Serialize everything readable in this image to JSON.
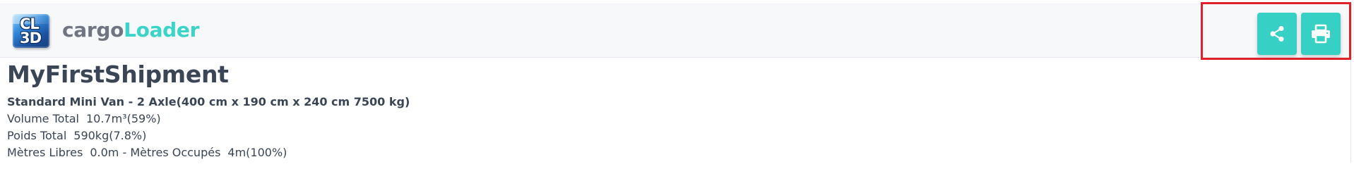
{
  "header": {
    "logo": {
      "line1": "CL",
      "line2": "3D"
    },
    "brand_part1": "cargo",
    "brand_part2": "Loader",
    "actions": [
      {
        "name": "share",
        "icon": "share-icon"
      },
      {
        "name": "print",
        "icon": "printer-icon"
      }
    ]
  },
  "shipment": {
    "title": "MyFirstShipment",
    "vehicle": "Standard Mini Van - 2 Axle(400 cm x 190 cm x 240 cm 7500 kg)",
    "volume_label": "Volume Total",
    "volume_value": "10.7m³(59%)",
    "poids_label": "Poids Total",
    "poids_value": "590kg(7.8%)",
    "metres_libres_label": "Mètres Libres",
    "metres_libres_value": "0.0m - Mètres Occupés",
    "metres_occupes_value": "4m(100%)"
  },
  "colors": {
    "accent": "#36d1c4",
    "brand_teal": "#3ad4c8",
    "brand_gray": "#6f7682",
    "text": "#3a4556",
    "highlight": "#e0212a"
  }
}
